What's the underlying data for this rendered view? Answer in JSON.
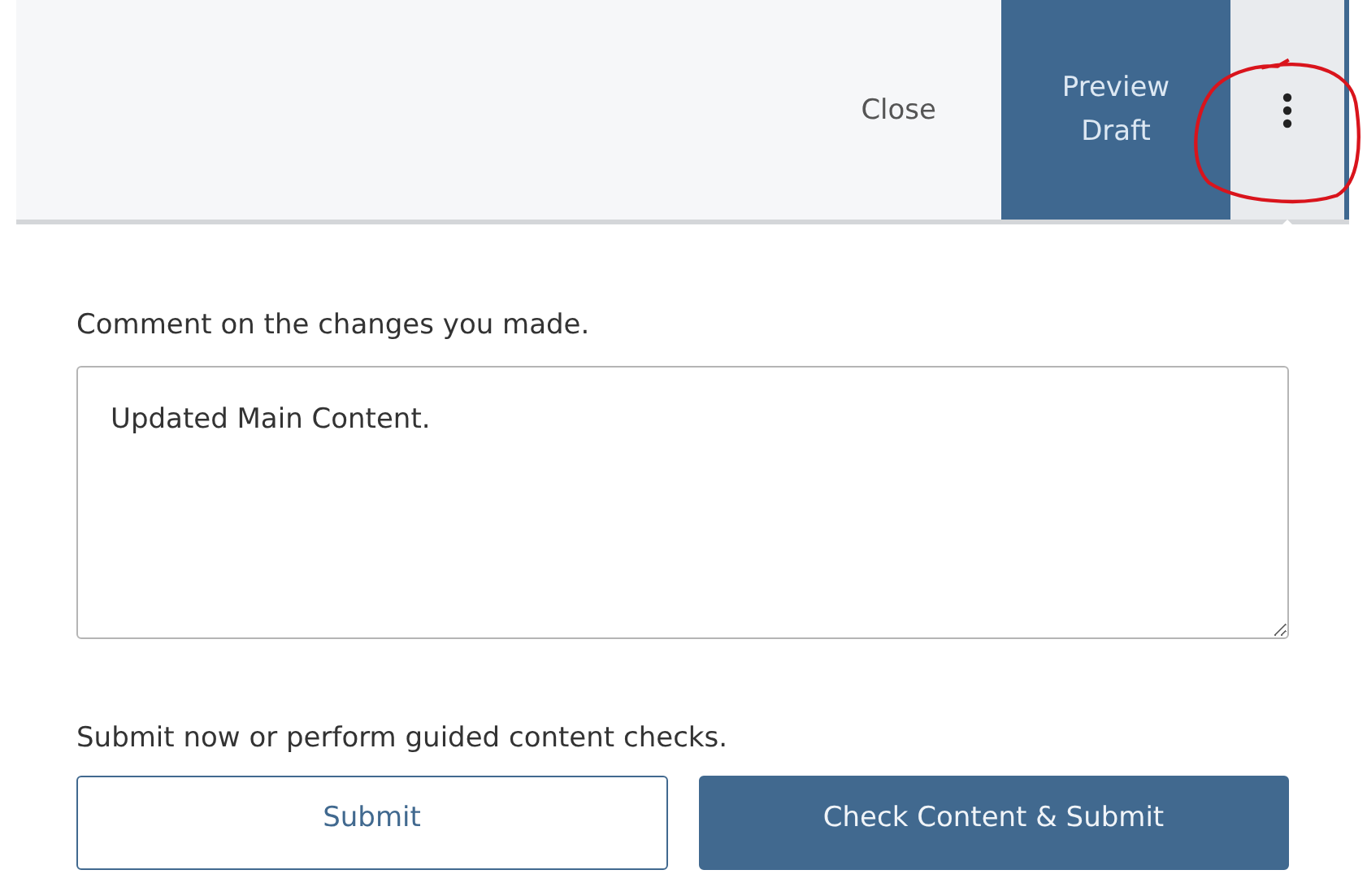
{
  "top_bar": {
    "buttons": [
      {
        "kind": "plain",
        "label": "Close"
      },
      {
        "kind": "primary",
        "label": "Preview\nDraft"
      },
      {
        "kind": "menu"
      }
    ]
  },
  "comment": {
    "label": "Comment on the changes you made.",
    "value": "Updated Main Content."
  },
  "submit_section": {
    "label": "Submit now or perform guided content checks.",
    "buttons": [
      {
        "kind": "outline",
        "label": "Submit"
      },
      {
        "kind": "primary",
        "label": "Check Content & Submit"
      }
    ]
  }
}
